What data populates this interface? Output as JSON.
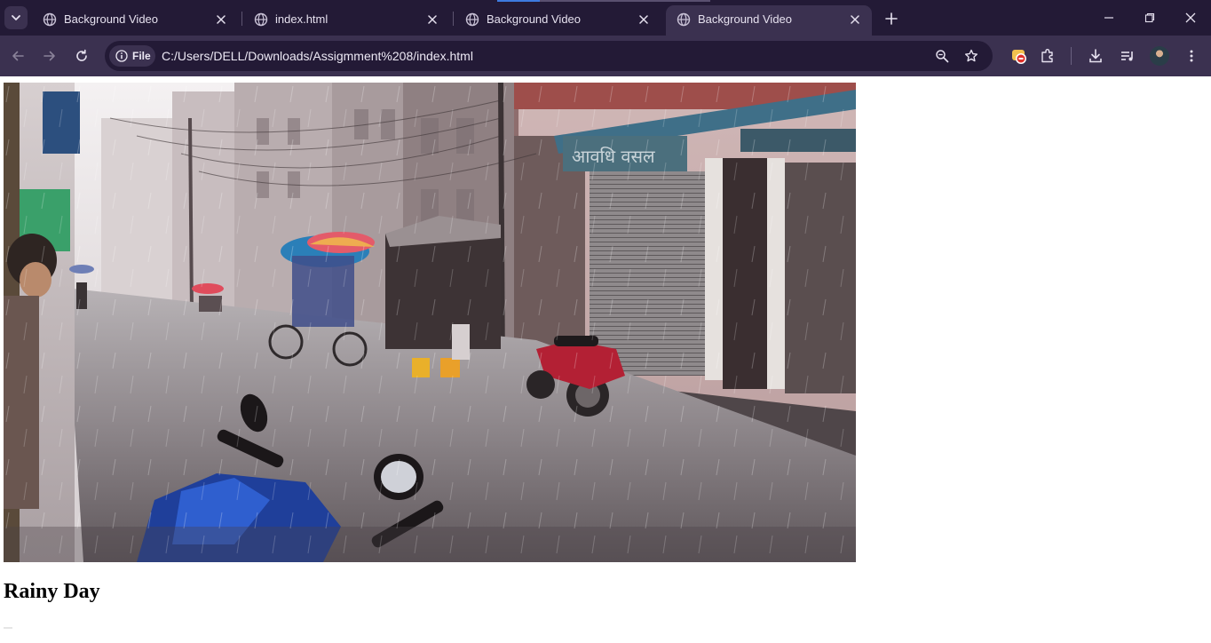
{
  "browser": {
    "tabs": [
      {
        "title": "Background Video",
        "active": false
      },
      {
        "title": "index.html",
        "active": false
      },
      {
        "title": "Background Video",
        "active": false
      },
      {
        "title": "Background Video",
        "active": true
      }
    ],
    "address_chip": "File",
    "url": "C:/Users/DELL/Downloads/Assigmment%208/index.html"
  },
  "page": {
    "heading": "Rainy Day",
    "video_content": "rainy street scene"
  },
  "icons": {
    "tab_search": "chevron-down-icon",
    "favicon": "globe-icon",
    "close": "close-icon",
    "new_tab": "plus-icon",
    "back": "arrow-left-icon",
    "forward": "arrow-right-icon",
    "reload": "reload-icon",
    "info": "info-icon",
    "zoom": "zoom-icon",
    "bookmark": "star-icon",
    "extension_badge": "extension-icon",
    "extensions": "puzzle-icon",
    "downloads": "download-icon",
    "media": "media-control-icon",
    "profile": "avatar",
    "menu": "kebab-menu-icon"
  },
  "colors": {
    "tabstrip_bg": "#231a36",
    "toolbar_bg": "#3b3150",
    "omnibox_bg": "#231a36",
    "text_light": "#e6e1ef",
    "page_bg": "#ffffff"
  }
}
